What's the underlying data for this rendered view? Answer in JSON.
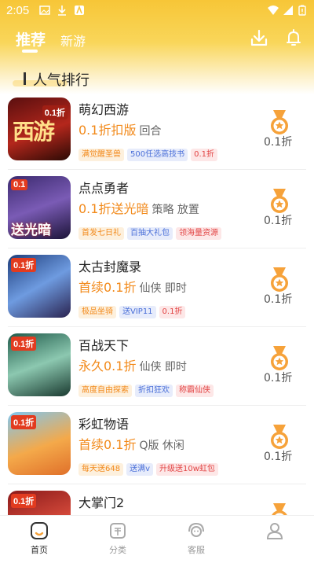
{
  "status_bar": {
    "time": "2:05"
  },
  "header": {
    "tabs": [
      {
        "label": "推荐",
        "active": true
      },
      {
        "label": "新游",
        "active": false
      }
    ],
    "icons": [
      "download-icon",
      "bell-icon"
    ],
    "accent_color": "#f7c637"
  },
  "section": {
    "title": "人气排行"
  },
  "games": [
    {
      "name": "萌幻西游",
      "promo": "0.1折扣版",
      "categories": "回合",
      "tags": [
        {
          "text": "满觉醒圣兽",
          "color": "orange"
        },
        {
          "text": "500任选高技书",
          "color": "blue"
        },
        {
          "text": "0.1折",
          "color": "red"
        }
      ],
      "discount": "0.1折",
      "thumb_text": "西游",
      "thumb_badge": "0.1折"
    },
    {
      "name": "点点勇者",
      "promo": "0.1折送光暗",
      "categories": "策略 放置",
      "tags": [
        {
          "text": "首发七日礼",
          "color": "orange"
        },
        {
          "text": "百抽大礼包",
          "color": "blue"
        },
        {
          "text": "领海量资源",
          "color": "red"
        }
      ],
      "discount": "0.1折",
      "thumb_text": "送光暗",
      "thumb_badge": "0.1"
    },
    {
      "name": "太古封魔录",
      "promo": "首续0.1折",
      "categories": "仙侠 即时",
      "tags": [
        {
          "text": "极品坐骑",
          "color": "orange"
        },
        {
          "text": "送VIP11",
          "color": "blue"
        },
        {
          "text": "0.1折",
          "color": "red"
        }
      ],
      "discount": "0.1折",
      "thumb_text": "",
      "thumb_badge": "0.1折"
    },
    {
      "name": "百战天下",
      "promo": "永久0.1折",
      "categories": "仙侠 即时",
      "tags": [
        {
          "text": "高度自由探索",
          "color": "orange"
        },
        {
          "text": "折扣狂欢",
          "color": "blue"
        },
        {
          "text": "称霸仙侠",
          "color": "red"
        }
      ],
      "discount": "0.1折",
      "thumb_text": "",
      "thumb_badge": "0.1折"
    },
    {
      "name": "彩虹物语",
      "promo": "首续0.1折",
      "categories": "Q版 休闲",
      "tags": [
        {
          "text": "每天送648",
          "color": "orange"
        },
        {
          "text": "送满v",
          "color": "blue"
        },
        {
          "text": "升级送10w虹包",
          "color": "red"
        }
      ],
      "discount": "0.1折",
      "thumb_text": "",
      "thumb_badge": "0.1折"
    },
    {
      "name": "大掌门2",
      "promo": "",
      "categories": "",
      "tags": [],
      "discount": "",
      "thumb_text": "",
      "thumb_badge": "0.1折"
    }
  ],
  "bottom_nav": [
    {
      "label": "首页",
      "icon": "home-icon",
      "active": true
    },
    {
      "label": "分类",
      "icon": "category-icon",
      "active": false
    },
    {
      "label": "客服",
      "icon": "customer-service-icon",
      "active": false
    },
    {
      "label": "",
      "icon": "user-icon",
      "active": false
    }
  ]
}
